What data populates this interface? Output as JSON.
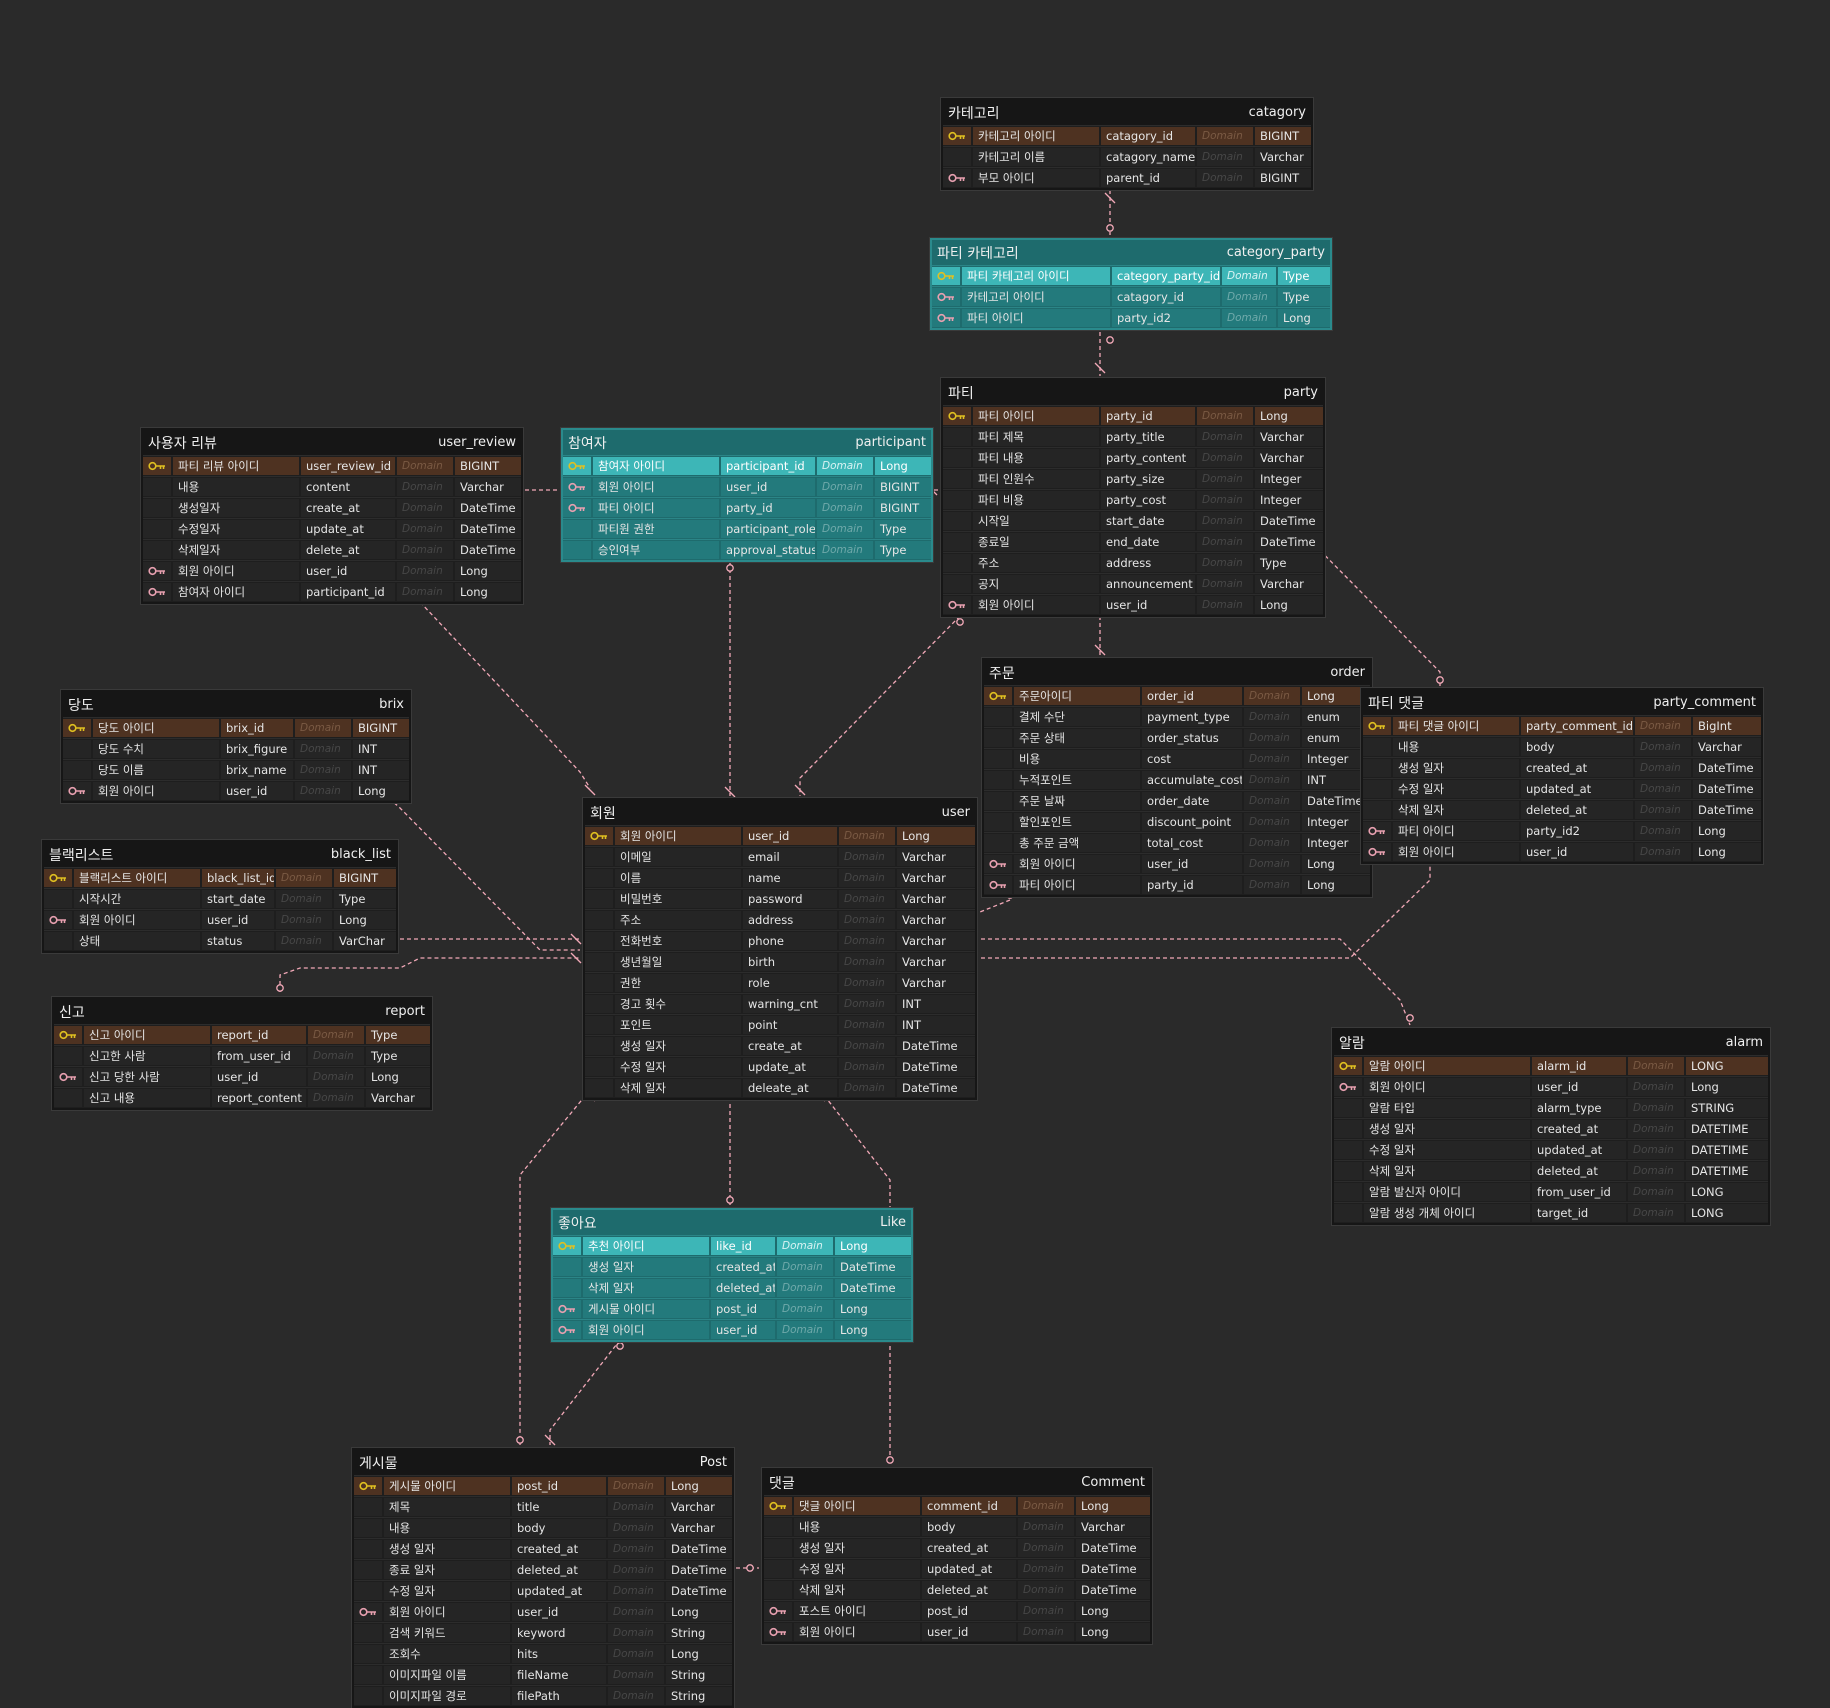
{
  "colors": {
    "background": "#2a2a2a",
    "table": "#1e1e1e",
    "teal": "#1e6b6d",
    "pk_row": "#4e3221",
    "relation_line": "#f2a9b8",
    "pk_key_icon": "#e0c020",
    "fk_key_icon": "#e8a0b0"
  },
  "icons": {
    "pk": "golden-key-icon",
    "fk": "pink-key-icon"
  },
  "tables": [
    {
      "id": "category",
      "name": "카테고리",
      "logical": "catagory",
      "teal": false,
      "rows": [
        {
          "key": "pk",
          "name": "카테고리 아이디",
          "column": "catagory_id",
          "domain": "Domain",
          "type": "BIGINT"
        },
        {
          "key": "",
          "name": "카테고리 이름",
          "column": "catagory_name",
          "domain": "Domain",
          "type": "Varchar"
        },
        {
          "key": "fk",
          "name": "부모 아이디",
          "column": "parent_id",
          "domain": "Domain",
          "type": "BIGINT"
        }
      ]
    },
    {
      "id": "category_party",
      "name": "파티 카테고리",
      "logical": "category_party",
      "teal": true,
      "rows": [
        {
          "key": "pk",
          "name": "파티 카테고리 아이디",
          "column": "category_party_id",
          "domain": "Domain",
          "type": "Type"
        },
        {
          "key": "fk",
          "name": "카테고리 아이디",
          "column": "catagory_id",
          "domain": "Domain",
          "type": "Type"
        },
        {
          "key": "fk",
          "name": "파티 아이디",
          "column": "party_id2",
          "domain": "Domain",
          "type": "Long"
        }
      ]
    },
    {
      "id": "party",
      "name": "파티",
      "logical": "party",
      "teal": false,
      "rows": [
        {
          "key": "pk",
          "name": "파티 아이디",
          "column": "party_id",
          "domain": "Domain",
          "type": "Long"
        },
        {
          "key": "",
          "name": "파티 제목",
          "column": "party_title",
          "domain": "Domain",
          "type": "Varchar"
        },
        {
          "key": "",
          "name": "파티 내용",
          "column": "party_content",
          "domain": "Domain",
          "type": "Varchar"
        },
        {
          "key": "",
          "name": "파티 인원수",
          "column": "party_size",
          "domain": "Domain",
          "type": "Integer"
        },
        {
          "key": "",
          "name": "파티 비용",
          "column": "party_cost",
          "domain": "Domain",
          "type": "Integer"
        },
        {
          "key": "",
          "name": "시작일",
          "column": "start_date",
          "domain": "Domain",
          "type": "DateTime"
        },
        {
          "key": "",
          "name": "종료일",
          "column": "end_date",
          "domain": "Domain",
          "type": "DateTime"
        },
        {
          "key": "",
          "name": "주소",
          "column": "address",
          "domain": "Domain",
          "type": "Type"
        },
        {
          "key": "",
          "name": "공지",
          "column": "announcement",
          "domain": "Domain",
          "type": "Varchar"
        },
        {
          "key": "fk",
          "name": "회원 아이디",
          "column": "user_id",
          "domain": "Domain",
          "type": "Long"
        }
      ]
    },
    {
      "id": "user_review",
      "name": "사용자 리뷰",
      "logical": "user_review",
      "teal": false,
      "rows": [
        {
          "key": "pk",
          "name": "파티 리뷰 아이디",
          "column": "user_review_id",
          "domain": "Domain",
          "type": "BIGINT"
        },
        {
          "key": "",
          "name": "내용",
          "column": "content",
          "domain": "Domain",
          "type": "Varchar"
        },
        {
          "key": "",
          "name": "생성일자",
          "column": "create_at",
          "domain": "Domain",
          "type": "DateTime"
        },
        {
          "key": "",
          "name": "수정일자",
          "column": "update_at",
          "domain": "Domain",
          "type": "DateTime"
        },
        {
          "key": "",
          "name": "삭제일자",
          "column": "delete_at",
          "domain": "Domain",
          "type": "DateTime"
        },
        {
          "key": "fk",
          "name": "회원 아이디",
          "column": "user_id",
          "domain": "Domain",
          "type": "Long"
        },
        {
          "key": "fk",
          "name": "참여자 아이디",
          "column": "participant_id",
          "domain": "Domain",
          "type": "Long"
        }
      ]
    },
    {
      "id": "participant",
      "name": "참여자",
      "logical": "participant",
      "teal": true,
      "rows": [
        {
          "key": "pk",
          "name": "참여자 아이디",
          "column": "participant_id",
          "domain": "Domain",
          "type": "Long"
        },
        {
          "key": "fk",
          "name": "회원 아이디",
          "column": "user_id",
          "domain": "Domain",
          "type": "BIGINT"
        },
        {
          "key": "fk",
          "name": "파티 아이디",
          "column": "party_id",
          "domain": "Domain",
          "type": "BIGINT"
        },
        {
          "key": "",
          "name": "파티원 권한",
          "column": "participant_role",
          "domain": "Domain",
          "type": "Type"
        },
        {
          "key": "",
          "name": "승인여부",
          "column": "approval_status",
          "domain": "Domain",
          "type": "Type"
        }
      ]
    },
    {
      "id": "brix",
      "name": "당도",
      "logical": "brix",
      "teal": false,
      "rows": [
        {
          "key": "pk",
          "name": "당도 아이디",
          "column": "brix_id",
          "domain": "Domain",
          "type": "BIGINT"
        },
        {
          "key": "",
          "name": "당도 수치",
          "column": "brix_figure",
          "domain": "Domain",
          "type": "INT"
        },
        {
          "key": "",
          "name": "당도 이름",
          "column": "brix_name",
          "domain": "Domain",
          "type": "INT"
        },
        {
          "key": "fk",
          "name": "회원 아이디",
          "column": "user_id",
          "domain": "Domain",
          "type": "Long"
        }
      ]
    },
    {
      "id": "black_list",
      "name": "블랙리스트",
      "logical": "black_list",
      "teal": false,
      "rows": [
        {
          "key": "pk",
          "name": "블랙리스트 아이디",
          "column": "black_list_id",
          "domain": "Domain",
          "type": "BIGINT"
        },
        {
          "key": "",
          "name": "시작시간",
          "column": "start_date",
          "domain": "Domain",
          "type": "Type"
        },
        {
          "key": "fk",
          "name": "회원 아이디",
          "column": "user_id",
          "domain": "Domain",
          "type": "Long"
        },
        {
          "key": "",
          "name": "상태",
          "column": "status",
          "domain": "Domain",
          "type": "VarChar"
        }
      ]
    },
    {
      "id": "report",
      "name": "신고",
      "logical": "report",
      "teal": false,
      "rows": [
        {
          "key": "pk",
          "name": "신고 아이디",
          "column": "report_id",
          "domain": "Domain",
          "type": "Type"
        },
        {
          "key": "",
          "name": "신고한 사람",
          "column": "from_user_id",
          "domain": "Domain",
          "type": "Type"
        },
        {
          "key": "fk",
          "name": "신고 당한 사람",
          "column": "user_id",
          "domain": "Domain",
          "type": "Long"
        },
        {
          "key": "",
          "name": "신고 내용",
          "column": "report_content",
          "domain": "Domain",
          "type": "Varchar"
        }
      ]
    },
    {
      "id": "user",
      "name": "회원",
      "logical": "user",
      "teal": false,
      "rows": [
        {
          "key": "pk",
          "name": "회원 아이디",
          "column": "user_id",
          "domain": "Domain",
          "type": "Long"
        },
        {
          "key": "",
          "name": "이메일",
          "column": "email",
          "domain": "Domain",
          "type": "Varchar"
        },
        {
          "key": "",
          "name": "이름",
          "column": "name",
          "domain": "Domain",
          "type": "Varchar"
        },
        {
          "key": "",
          "name": "비밀번호",
          "column": "password",
          "domain": "Domain",
          "type": "Varchar"
        },
        {
          "key": "",
          "name": "주소",
          "column": "address",
          "domain": "Domain",
          "type": "Varchar"
        },
        {
          "key": "",
          "name": "전화번호",
          "column": "phone",
          "domain": "Domain",
          "type": "Varchar"
        },
        {
          "key": "",
          "name": "생년월일",
          "column": "birth",
          "domain": "Domain",
          "type": "Varchar"
        },
        {
          "key": "",
          "name": "권한",
          "column": "role",
          "domain": "Domain",
          "type": "Varchar"
        },
        {
          "key": "",
          "name": "경고 횟수",
          "column": "warning_cnt",
          "domain": "Domain",
          "type": "INT"
        },
        {
          "key": "",
          "name": "포인트",
          "column": "point",
          "domain": "Domain",
          "type": "INT"
        },
        {
          "key": "",
          "name": "생성 일자",
          "column": "create_at",
          "domain": "Domain",
          "type": "DateTime"
        },
        {
          "key": "",
          "name": "수정 일자",
          "column": "update_at",
          "domain": "Domain",
          "type": "DateTime"
        },
        {
          "key": "",
          "name": "삭제 일자",
          "column": "deleate_at",
          "domain": "Domain",
          "type": "DateTime"
        }
      ]
    },
    {
      "id": "order",
      "name": "주문",
      "logical": "order",
      "teal": false,
      "rows": [
        {
          "key": "pk",
          "name": "주문아이디",
          "column": "order_id",
          "domain": "Domain",
          "type": "Long"
        },
        {
          "key": "",
          "name": "결제 수단",
          "column": "payment_type",
          "domain": "Domain",
          "type": "enum"
        },
        {
          "key": "",
          "name": "주문 상태",
          "column": "order_status",
          "domain": "Domain",
          "type": "enum"
        },
        {
          "key": "",
          "name": "비용",
          "column": "cost",
          "domain": "Domain",
          "type": "Integer"
        },
        {
          "key": "",
          "name": "누적포인트",
          "column": "accumulate_cost",
          "domain": "Domain",
          "type": "INT"
        },
        {
          "key": "",
          "name": "주문 날짜",
          "column": "order_date",
          "domain": "Domain",
          "type": "DateTime"
        },
        {
          "key": "",
          "name": "할인포인트",
          "column": "discount_point",
          "domain": "Domain",
          "type": "Integer"
        },
        {
          "key": "",
          "name": "총 주문 금액",
          "column": "total_cost",
          "domain": "Domain",
          "type": "Integer"
        },
        {
          "key": "fk",
          "name": "회원 아이디",
          "column": "user_id",
          "domain": "Domain",
          "type": "Long"
        },
        {
          "key": "fk",
          "name": "파티 아이디",
          "column": "party_id",
          "domain": "Domain",
          "type": "Long"
        }
      ]
    },
    {
      "id": "party_comment",
      "name": "파티 댓글",
      "logical": "party_comment",
      "teal": false,
      "rows": [
        {
          "key": "pk",
          "name": "파티 댓글 아이디",
          "column": "party_comment_id",
          "domain": "Domain",
          "type": "BigInt"
        },
        {
          "key": "",
          "name": "내용",
          "column": "body",
          "domain": "Domain",
          "type": "Varchar"
        },
        {
          "key": "",
          "name": "생성 일자",
          "column": "created_at",
          "domain": "Domain",
          "type": "DateTime"
        },
        {
          "key": "",
          "name": "수정 일자",
          "column": "updated_at",
          "domain": "Domain",
          "type": "DateTime"
        },
        {
          "key": "",
          "name": "삭제 일자",
          "column": "deleted_at",
          "domain": "Domain",
          "type": "DateTime"
        },
        {
          "key": "fk",
          "name": "파티 아이디",
          "column": "party_id2",
          "domain": "Domain",
          "type": "Long"
        },
        {
          "key": "fk",
          "name": "회원 아이디",
          "column": "user_id",
          "domain": "Domain",
          "type": "Long"
        }
      ]
    },
    {
      "id": "alarm",
      "name": "알람",
      "logical": "alarm",
      "teal": false,
      "rows": [
        {
          "key": "pk",
          "name": "알람 아이디",
          "column": "alarm_id",
          "domain": "Domain",
          "type": "LONG"
        },
        {
          "key": "fk",
          "name": "회원 아이디",
          "column": "user_id",
          "domain": "Domain",
          "type": "Long"
        },
        {
          "key": "",
          "name": "알람 타입",
          "column": "alarm_type",
          "domain": "Domain",
          "type": "STRING"
        },
        {
          "key": "",
          "name": "생성 일자",
          "column": "created_at",
          "domain": "Domain",
          "type": "DATETIME"
        },
        {
          "key": "",
          "name": "수정 일자",
          "column": "updated_at",
          "domain": "Domain",
          "type": "DATETIME"
        },
        {
          "key": "",
          "name": "삭제 일자",
          "column": "deleted_at",
          "domain": "Domain",
          "type": "DATETIME"
        },
        {
          "key": "",
          "name": "알람 발신자 아이디",
          "column": "from_user_id",
          "domain": "Domain",
          "type": "LONG"
        },
        {
          "key": "",
          "name": "알람 생성 개체 아이디",
          "column": "target_id",
          "domain": "Domain",
          "type": "LONG"
        }
      ]
    },
    {
      "id": "like",
      "name": "좋아요",
      "logical": "Like",
      "teal": true,
      "rows": [
        {
          "key": "pk",
          "name": "추천 아이디",
          "column": "like_id",
          "domain": "Domain",
          "type": "Long"
        },
        {
          "key": "",
          "name": "생성 일자",
          "column": "created_at",
          "domain": "Domain",
          "type": "DateTime"
        },
        {
          "key": "",
          "name": "삭제 일자",
          "column": "deleted_at",
          "domain": "Domain",
          "type": "DateTime"
        },
        {
          "key": "fk",
          "name": "게시물 아이디",
          "column": "post_id",
          "domain": "Domain",
          "type": "Long"
        },
        {
          "key": "fk",
          "name": "회원 아이디",
          "column": "user_id",
          "domain": "Domain",
          "type": "Long"
        }
      ]
    },
    {
      "id": "post",
      "name": "게시물",
      "logical": "Post",
      "teal": false,
      "rows": [
        {
          "key": "pk",
          "name": "게시물 아이디",
          "column": "post_id",
          "domain": "Domain",
          "type": "Long"
        },
        {
          "key": "",
          "name": "제목",
          "column": "title",
          "domain": "Domain",
          "type": "Varchar"
        },
        {
          "key": "",
          "name": "내용",
          "column": "body",
          "domain": "Domain",
          "type": "Varchar"
        },
        {
          "key": "",
          "name": "생성 일자",
          "column": "created_at",
          "domain": "Domain",
          "type": "DateTime"
        },
        {
          "key": "",
          "name": "종료 일자",
          "column": "deleted_at",
          "domain": "Domain",
          "type": "DateTime"
        },
        {
          "key": "",
          "name": "수정 일자",
          "column": "updated_at",
          "domain": "Domain",
          "type": "DateTime"
        },
        {
          "key": "fk",
          "name": "회원 아이디",
          "column": "user_id",
          "domain": "Domain",
          "type": "Long"
        },
        {
          "key": "",
          "name": "검색 키워드",
          "column": "keyword",
          "domain": "Domain",
          "type": "String"
        },
        {
          "key": "",
          "name": "조회수",
          "column": "hits",
          "domain": "Domain",
          "type": "Long"
        },
        {
          "key": "",
          "name": "이미지파일 이름",
          "column": "fileName",
          "domain": "Domain",
          "type": "String"
        },
        {
          "key": "",
          "name": "이미지파일 경로",
          "column": "filePath",
          "domain": "Domain",
          "type": "String"
        }
      ]
    },
    {
      "id": "comment",
      "name": "댓글",
      "logical": "Comment",
      "teal": false,
      "rows": [
        {
          "key": "pk",
          "name": "댓글 아이디",
          "column": "comment_id",
          "domain": "Domain",
          "type": "Long"
        },
        {
          "key": "",
          "name": "내용",
          "column": "body",
          "domain": "Domain",
          "type": "Varchar"
        },
        {
          "key": "",
          "name": "생성 일자",
          "column": "created_at",
          "domain": "Domain",
          "type": "DateTime"
        },
        {
          "key": "",
          "name": "수정 일자",
          "column": "updated_at",
          "domain": "Domain",
          "type": "DateTime"
        },
        {
          "key": "",
          "name": "삭제 일자",
          "column": "deleted_at",
          "domain": "Domain",
          "type": "DateTime"
        },
        {
          "key": "fk",
          "name": "포스트 아이디",
          "column": "post_id",
          "domain": "Domain",
          "type": "Long"
        },
        {
          "key": "fk",
          "name": "회원 아이디",
          "column": "user_id",
          "domain": "Domain",
          "type": "Long"
        }
      ]
    }
  ]
}
